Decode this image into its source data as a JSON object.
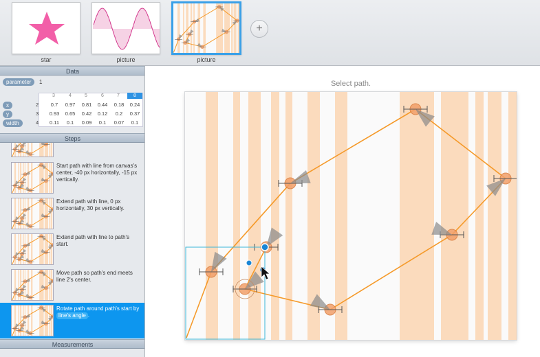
{
  "filmstrip": {
    "items": [
      {
        "label": "star"
      },
      {
        "label": "picture"
      },
      {
        "label": "picture"
      }
    ],
    "add_label": "+"
  },
  "data_panel": {
    "header": "Data",
    "parameter": {
      "name": "parameter",
      "value": "1"
    },
    "columns": [
      "3",
      "4",
      "5",
      "6",
      "7",
      "8"
    ],
    "selected_column": "8",
    "rows": [
      {
        "name": "x",
        "values": [
          "2",
          "0.7",
          "0.97",
          "0.81",
          "0.44",
          "0.18",
          "0.24"
        ]
      },
      {
        "name": "y",
        "values": [
          "3",
          "0.93",
          "0.65",
          "0.42",
          "0.12",
          "0.2",
          "0.37"
        ]
      },
      {
        "name": "width",
        "values": [
          "4",
          "0.11",
          "0.1",
          "0.09",
          "0.1",
          "0.07",
          "0.1"
        ]
      }
    ]
  },
  "steps_panel": {
    "header": "Steps",
    "steps": [
      {
        "text": "Start path with line from canvas's center, -40 px horizontally, -15 px vertically."
      },
      {
        "text": "Extend path with line, 0 px horizontally, 30 px vertically."
      },
      {
        "text": "Extend path with line to path's start."
      },
      {
        "text": "Move path so path's end meets line 2's center."
      },
      {
        "text": "Rotate path around path's start by",
        "token": "line's angle",
        "suffix": "."
      }
    ]
  },
  "measurements_panel": {
    "header": "Measurements"
  },
  "canvas": {
    "instruction": "Select path.",
    "accent": "#f59a2a",
    "stripe_color": "#fbd3ae",
    "selection_color": "#3ab5d8",
    "handle_color": "#1a86d6"
  }
}
